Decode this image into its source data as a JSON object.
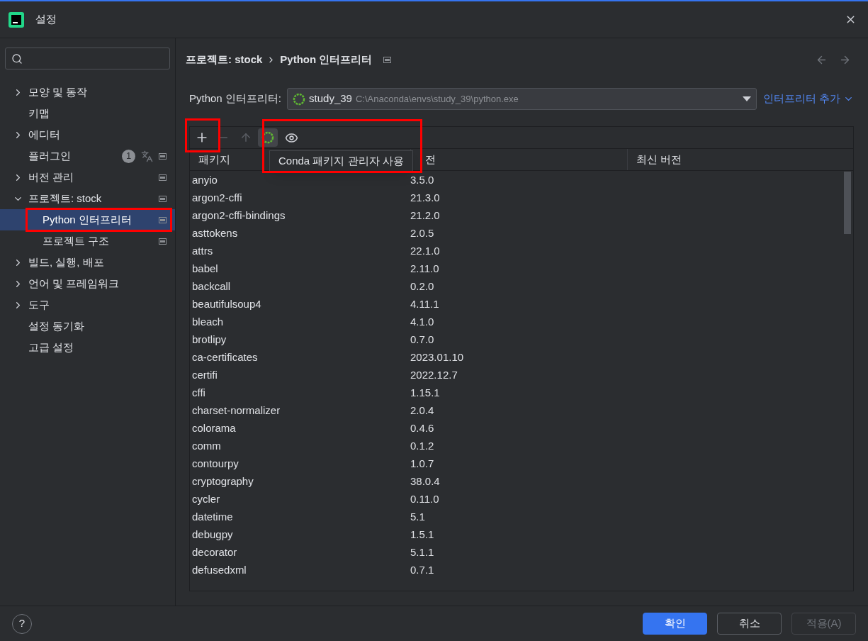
{
  "window": {
    "title": "설정"
  },
  "sidebar": {
    "items": [
      {
        "label": "모양 및 동작",
        "expanded": false,
        "selected": false
      },
      {
        "label": "키맵",
        "selected": false
      },
      {
        "label": "에디터",
        "expanded": false,
        "selected": false
      },
      {
        "label": "플러그인",
        "selected": false,
        "scope_icon": true,
        "badge": "1",
        "translate_icon": true
      },
      {
        "label": "버전 관리",
        "expanded": false,
        "selected": false,
        "scope_icon": true
      },
      {
        "label": "프로젝트: stock",
        "expanded": true,
        "selected": false,
        "scope_icon": true,
        "children": [
          {
            "label": "Python 인터프리터",
            "selected": true,
            "highlighted": true,
            "scope_icon": true
          },
          {
            "label": "프로젝트 구조",
            "selected": false,
            "scope_icon": true
          }
        ]
      },
      {
        "label": "빌드, 실행, 배포",
        "expanded": false,
        "selected": false
      },
      {
        "label": "언어 및 프레임워크",
        "expanded": false,
        "selected": false
      },
      {
        "label": "도구",
        "expanded": false,
        "selected": false
      },
      {
        "label": "설정 동기화",
        "selected": false
      },
      {
        "label": "고급 설정",
        "selected": false
      }
    ]
  },
  "breadcrumb": [
    "프로젝트: stock",
    "Python 인터프리터"
  ],
  "interpreter": {
    "label": "Python 인터프리터:",
    "name": "study_39",
    "path": "C:\\Anaconda\\envs\\study_39\\python.exe",
    "add_link": "인터프리터 추가"
  },
  "toolbar": {
    "add_highlighted": true,
    "conda_highlighted": true,
    "conda_active": true,
    "tooltip": "Conda 패키지 관리자 사용"
  },
  "table": {
    "columns": [
      "패키지",
      "전",
      "최신 버전"
    ],
    "rows": [
      [
        "anyio",
        "3.5.0"
      ],
      [
        "argon2-cffi",
        "21.3.0"
      ],
      [
        "argon2-cffi-bindings",
        "21.2.0"
      ],
      [
        "asttokens",
        "2.0.5"
      ],
      [
        "attrs",
        "22.1.0"
      ],
      [
        "babel",
        "2.11.0"
      ],
      [
        "backcall",
        "0.2.0"
      ],
      [
        "beautifulsoup4",
        "4.11.1"
      ],
      [
        "bleach",
        "4.1.0"
      ],
      [
        "brotlipy",
        "0.7.0"
      ],
      [
        "ca-certificates",
        "2023.01.10"
      ],
      [
        "certifi",
        "2022.12.7"
      ],
      [
        "cffi",
        "1.15.1"
      ],
      [
        "charset-normalizer",
        "2.0.4"
      ],
      [
        "colorama",
        "0.4.6"
      ],
      [
        "comm",
        "0.1.2"
      ],
      [
        "contourpy",
        "1.0.7"
      ],
      [
        "cryptography",
        "38.0.4"
      ],
      [
        "cycler",
        "0.11.0"
      ],
      [
        "datetime",
        "5.1"
      ],
      [
        "debugpy",
        "1.5.1"
      ],
      [
        "decorator",
        "5.1.1"
      ],
      [
        "defusedxml",
        "0.7.1"
      ]
    ]
  },
  "footer": {
    "help": "?",
    "buttons": [
      {
        "label": "확인",
        "kind": "primary",
        "disabled": false
      },
      {
        "label": "취소",
        "kind": "normal",
        "disabled": false
      },
      {
        "label": "적용(A)",
        "kind": "normal",
        "disabled": true
      }
    ]
  }
}
